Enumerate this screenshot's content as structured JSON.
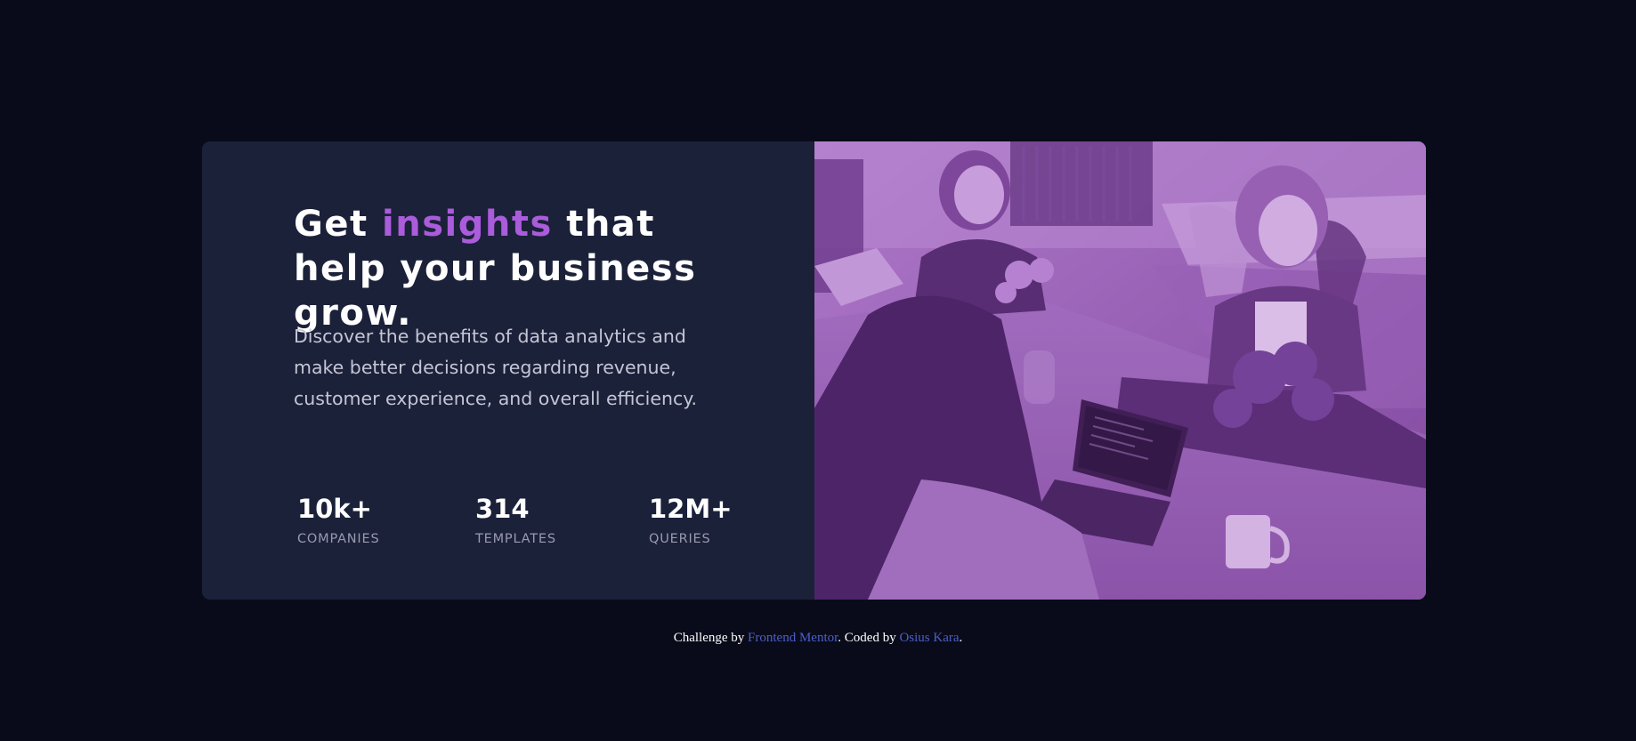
{
  "card": {
    "headline": {
      "part1": "Get ",
      "highlight": "insights",
      "part2": " that help your business grow."
    },
    "description": "Discover the benefits of data analytics and make better decisions regarding revenue, customer experience, and overall efficiency.",
    "stats": [
      {
        "value": "10k+",
        "label": "COMPANIES"
      },
      {
        "value": "314",
        "label": "TEMPLATES"
      },
      {
        "value": "12M+",
        "label": "QUERIES"
      }
    ],
    "image_description_icon": "office-team-photo"
  },
  "attribution": {
    "prefix": "Challenge by ",
    "mentor_link": "Frontend Mentor",
    "middle": ". Coded by ",
    "author_link": "Osius Kara",
    "suffix": "."
  },
  "colors": {
    "background": "#090b1a",
    "card": "#1b2139",
    "accent": "#aa5cdb",
    "image_tint": "#8c5aa6",
    "link": "#4c5fc8"
  }
}
